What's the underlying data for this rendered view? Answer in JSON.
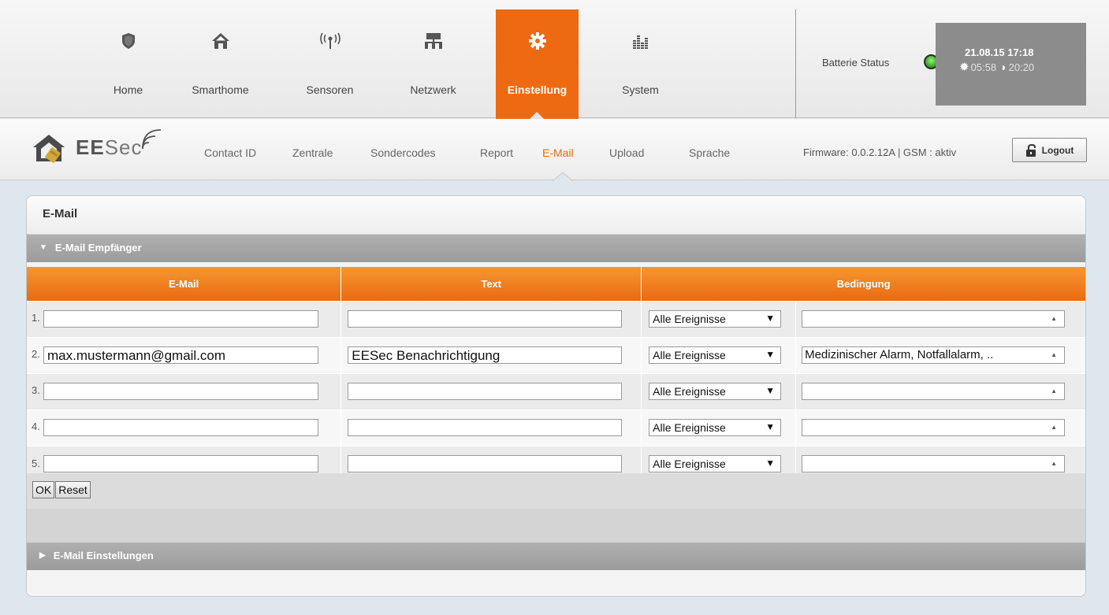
{
  "nav": {
    "items": [
      {
        "label": "Home",
        "icon": "shield-icon"
      },
      {
        "label": "Smarthome",
        "icon": "house-icon"
      },
      {
        "label": "Sensoren",
        "icon": "antenna-icon"
      },
      {
        "label": "Netzwerk",
        "icon": "network-icon"
      },
      {
        "label": "Einstellung",
        "icon": "gear-icon"
      },
      {
        "label": "System",
        "icon": "bar-chart-icon"
      }
    ],
    "active": "Einstellung"
  },
  "status": {
    "battery_label": "Batterie Status",
    "battery_color": "#3fb22a",
    "datetime": "21.08.15 17:18",
    "sunrise": "05:58",
    "sunset": "20:20"
  },
  "brand": {
    "prefix": "EE",
    "suffix": "Sec"
  },
  "subnav": {
    "items": [
      "Contact ID",
      "Zentrale",
      "Sondercodes",
      "Report",
      "E-Mail",
      "Upload",
      "Sprache"
    ],
    "active": "E-Mail"
  },
  "firmware": "Firmware: 0.0.2.12A | GSM : aktiv",
  "logout_label": "Logout",
  "panel": {
    "title": "E-Mail",
    "section_recipients": "E-Mail Empfänger",
    "section_settings": "E-Mail Einstellungen",
    "columns": {
      "email": "E-Mail",
      "text": "Text",
      "condition": "Bedingung"
    },
    "rows": [
      {
        "num": "1.",
        "email": "",
        "text": "",
        "select": "Alle Ereignisse",
        "events": ""
      },
      {
        "num": "2.",
        "email": "max.mustermann@gmail.com",
        "text": "EESec Benachrichtigung",
        "select": "Alle Ereignisse",
        "events": "Medizinischer Alarm, Notfallalarm, .."
      },
      {
        "num": "3.",
        "email": "",
        "text": "",
        "select": "Alle Ereignisse",
        "events": ""
      },
      {
        "num": "4.",
        "email": "",
        "text": "",
        "select": "Alle Ereignisse",
        "events": ""
      },
      {
        "num": "5.",
        "email": "",
        "text": "",
        "select": "Alle Ereignisse",
        "events": ""
      }
    ],
    "ok_label": "OK",
    "reset_label": "Reset"
  },
  "accent_color": "#ee6a12"
}
